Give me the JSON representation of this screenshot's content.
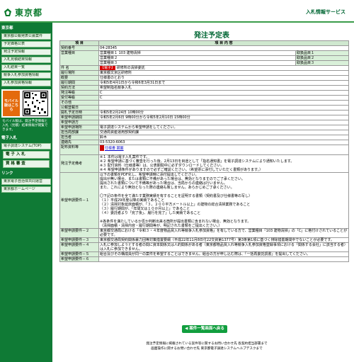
{
  "header": {
    "logo_text": "東京都",
    "service_label": "入札情報サービス"
  },
  "sidebar": {
    "section1_heading": "東京都",
    "links": [
      "東京都公報発表公募案件",
      "予定価格公表",
      "発注予定情報",
      "入札見積結果情報",
      "入札結果一覧",
      "競争入札参加資格情報",
      "入札参加資格情報"
    ],
    "mobile_badge": "モバイル版はこちら",
    "mobile_note": "モバイル版は、発注予定情報と入札（見積）結果情報が閲覧できます。",
    "section2_heading": "電子入札",
    "system_links": [
      "電子調達システム(TOP)",
      "電 子 入 札",
      "資 格 審 査"
    ],
    "section3_heading": "リンク",
    "bottom_links": [
      "東京電子自治体共同運営",
      "東京都ホームページ"
    ]
  },
  "page": {
    "title": "発注予定表"
  },
  "table": {
    "header_item": "項 目",
    "header_content": "項 目 内 容",
    "rows": [
      {
        "label": "契約番号",
        "value": "04-28345"
      },
      {
        "label": "営業種目",
        "value": "営業種目１ 103 建物清掃",
        "extra": "取扱品目１"
      },
      {
        "label": "",
        "value": "営業種目２",
        "extra": "取扱品目２"
      },
      {
        "label": "",
        "value": "営業種目３",
        "extra": "取扱品目３"
      },
      {
        "label": "件 名",
        "tag": "【電子】",
        "value": "研修所の清掃委託"
      },
      {
        "label": "履行場所",
        "value": "東京都文京区研修所"
      },
      {
        "label": "概要",
        "value": "仕様書のとおり"
      },
      {
        "label": "履行期間",
        "value": "令和5年4月1日から令和6年3月31日まで"
      },
      {
        "label": "契約方法",
        "value": "希望制指名競争入札"
      },
      {
        "label": "発注等級",
        "value": "C"
      },
      {
        "label": "受付等級",
        "value": "C"
      },
      {
        "label": "その他",
        "value": ""
      },
      {
        "label": "公報登載日",
        "value": ""
      },
      {
        "label": "開札予定日時",
        "value": "令和5年2月24日 10時00分"
      },
      {
        "label": "希望申請期間",
        "value": "令和5年2月6日 9時00分から令和5年2月10日 15時00分"
      },
      {
        "label": "希望申請方",
        "value": ""
      },
      {
        "label": "希望申請場所",
        "value": "電子調達システムから希望申請をしてください。"
      },
      {
        "label": "担当局部課",
        "value": "交通局資産運用部契約課"
      },
      {
        "label": "担当者",
        "value": "鈴木"
      },
      {
        "label": "連絡先",
        "value": "03-5320-6063"
      },
      {
        "label": "配布資料等",
        "value": "仕様書   図面"
      }
    ],
    "notes_label": "発注予定備考",
    "notes": [
      "※１ 本件は電子入札案件です。",
      "※２ 希望申請に基づく審査を行った後、2月13日を目途として「指名通知書」を電子調達システムにより通知いたします。",
      "※３ 配付資料（仕様書等）は、公表期間中に必ずダウンロードしてください。",
      "※４ 希望申請条件がありますので必ずご確認ください。（希望票に添付していただく書類があります。）"
    ],
    "cond1_label": "希望申請要件－１",
    "cond1": [
      "以下の書類をPDF化し、希望申請時に添付提出してください。",
      "提出が無い場合、または書類に不備があった場合は、無効となりますのでご了承ください。",
      "提出された書類について不備等があった場合は、当局からの連絡は行いません。",
      "また、これにより無効となった際の連絡も致しません。あらかじめご了承ください。",
      "",
      "〇下記の条件を全て満たす業務実績を有することを証明する書類（契約書及び仕様書等の写し）",
      "（１）平成29年度以降の実績であること",
      "（２）清掃対象延床面積が、「３，２００平方メートル以上」の建物の総合清掃業務であること",
      "（３）履行期間が、「年間又は１０か月以上」であること",
      "（４）委託者より「完了後」、履行を完了」した実績であること",
      "",
      "※各条件を満たしているか否か判断出来る箇所が提出書類に含まれない場合、無効となります。",
      "（清掃面積・清掃内容・履行期間等が、明記された書類をご提出ください。）"
    ],
    "cond2_label": "希望申請要件－２",
    "cond2": "東京都交通局における「令和３・４年度物品買入れ等競争入札参加資格」を有している方で、営業種目「103 建物清掃」の「C」に格付けされていることが必要です。",
    "cond3_label": "希望申請要件－３",
    "cond3": "東京都交通局契約関係暴力団等対策措置要綱（平成22年11月8日付22交資第1377号）第3条第1項に基づく排除措置期間中でないことが必要です。",
    "cond4_label": "希望申請要件－４",
    "cond4": "入札に参加しようとする者の間に資本関係又は人的関係がある者（東京都物品買入れ等競争入札参加資格登録事項における「関係する会社」に該当する者）は入札に参加できません。",
    "cond5_label": "希望申請要件－５",
    "cond5": "組合及びその構成員が同一の案件を希望することはできません。組合の方が申し込む際は、「一括再委託調書」を提出してください。",
    "cond6_label": "希望申請要件－６",
    "cond6": ""
  },
  "back_button": "案件一覧画面へ戻る",
  "footer": [
    "発注予定情報に掲載されている案件等に関するお問い合わせ先 各契約担当部署まで",
    "画面操作に関するお問い合わせ先 東京都電子調達システムヘルプデスクまで"
  ]
}
